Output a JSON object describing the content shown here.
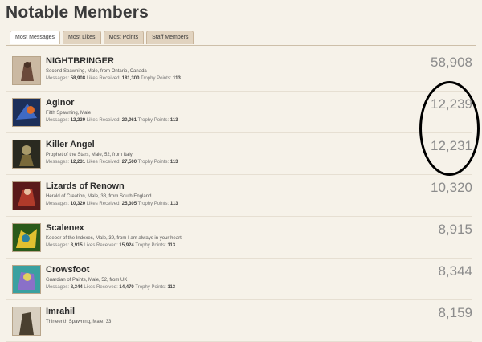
{
  "page": {
    "title": "Notable Members"
  },
  "tabs": [
    {
      "label": "Most Messages",
      "active": true
    },
    {
      "label": "Most Likes",
      "active": false
    },
    {
      "label": "Most Points",
      "active": false
    },
    {
      "label": "Staff Members",
      "active": false
    }
  ],
  "stat_labels": {
    "messages": "Messages:",
    "likes": "Likes Received:",
    "points": "Trophy Points:"
  },
  "members": [
    {
      "name": "NIGHTBRINGER",
      "info": "Second Spawning, Male, from Ontario, Canada",
      "messages": "58,908",
      "likes": "181,300",
      "points": "113",
      "count": "58,908",
      "avatar_color": "#6b4a3a"
    },
    {
      "name": "Aginor",
      "info": "Fifth Spawning, Male",
      "messages": "12,239",
      "likes": "20,061",
      "points": "113",
      "count": "12,239",
      "avatar_color": "#2a4a8a"
    },
    {
      "name": "Killer Angel",
      "info": "Prophet of the Stars, Male, 52, from Italy",
      "messages": "12,231",
      "likes": "27,500",
      "points": "113",
      "count": "12,231",
      "avatar_color": "#3a3a2a"
    },
    {
      "name": "Lizards of Renown",
      "info": "Herald of Creation, Male, 38, from South England",
      "messages": "10,320",
      "likes": "25,305",
      "points": "113",
      "count": "10,320",
      "avatar_color": "#8a2a2a"
    },
    {
      "name": "Scalenex",
      "info": "Keeper of the Indexes, Male, 39, from I am always in your heart",
      "messages": "8,915",
      "likes": "15,924",
      "points": "113",
      "count": "8,915",
      "avatar_color": "#3a6a2a"
    },
    {
      "name": "Crowsfoot",
      "info": "Guardian of Paints, Male, 52, from UK",
      "messages": "8,344",
      "likes": "14,470",
      "points": "113",
      "count": "8,344",
      "avatar_color": "#6a5aa0"
    },
    {
      "name": "Imrahil",
      "info": "Thirteenth Spawning, Male, 33",
      "messages": "",
      "likes": "",
      "points": "",
      "count": "8,159",
      "avatar_color": "#4a4030"
    }
  ]
}
